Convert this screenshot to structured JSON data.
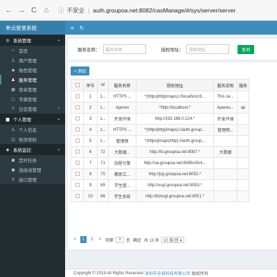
{
  "browser": {
    "back": "←",
    "forward": "→",
    "reload": "C",
    "home": "⌂",
    "info": "ⓘ",
    "security": "不安全",
    "url": "auth.groupoa.net:8082/casManage/#/sys/server/server"
  },
  "header": {
    "logo": "单点登录系统",
    "menu_icon": "≡",
    "refresh_icon": "↻"
  },
  "sidebar": {
    "groups": [
      {
        "label": "系统管理",
        "icon": "◎",
        "items": [
          {
            "label": "首页",
            "icon": "⌂"
          },
          {
            "label": "用户管理",
            "icon": "♙"
          },
          {
            "label": "角色管理",
            "icon": "◆"
          },
          {
            "label": "服务管理",
            "icon": "♟",
            "active": true
          },
          {
            "label": "菜单管理",
            "icon": "▦"
          },
          {
            "label": "字典管理",
            "icon": "▢"
          },
          {
            "label": "日志管理",
            "icon": "≡",
            "caret": "▾"
          }
        ]
      },
      {
        "label": "个人管理",
        "icon": "▆",
        "items": [
          {
            "label": "个人信息",
            "icon": "♙"
          },
          {
            "label": "修改密码",
            "icon": "◫"
          }
        ]
      },
      {
        "label": "系统监控",
        "icon": "◈",
        "items": [
          {
            "label": "定时任务",
            "icon": "◼"
          },
          {
            "label": "连接池管理",
            "icon": "◼"
          },
          {
            "label": "接口管理",
            "icon": "⚲"
          }
        ]
      }
    ]
  },
  "search": {
    "name_label": "服务名称：",
    "name_placeholder": "服务名称",
    "addr_label": "授权地址：",
    "addr_placeholder": "授权地址",
    "query_button": "查询"
  },
  "toolbar": {
    "add_button": "+ 添加"
  },
  "table": {
    "columns": [
      "序号",
      "id",
      "服务名称",
      "授权地址",
      "服务说明",
      "服务"
    ],
    "rows": [
      [
        "1",
        "1...",
        "HTTPS ...",
        "^(https|http|imaps)://localhost:8...",
        "This se...",
        ""
      ],
      [
        "2",
        "1...",
        "Apereo",
        "^http://localhost.*",
        "Apereo...",
        "ap"
      ],
      [
        "3",
        "1...",
        "开发环境",
        "http://192.168.0.124.*",
        "开发环境",
        ""
      ],
      [
        "4",
        "1...",
        "HTTPS ...",
        "^(https|http|imaps)://auth.group...",
        "管理侧...",
        ""
      ],
      [
        "5",
        "1...",
        "管理侧",
        "^(https|imaps|http)://auth.group...",
        "",
        ""
      ],
      [
        "6",
        "72",
        "大数据...",
        "http://bi.groupoa.net:8087.*",
        "大数据",
        ""
      ],
      [
        "7",
        "71",
        "流程引擎",
        "http://oa.groupoa.net:8085/v5mi...",
        "",
        ""
      ],
      [
        "8",
        "70",
        "教职工...",
        "http://jzg.groupoa.net:8052.*",
        "",
        ""
      ],
      [
        "9",
        "69",
        "学生管...",
        "http://xsgl.groupoa.net:8053.*",
        "",
        ""
      ],
      [
        "10",
        "68",
        "学生系统",
        "http://bzksgl.groupoa.net:8051.*",
        "",
        ""
      ]
    ]
  },
  "pager": {
    "prev": "<",
    "page1": "1",
    "page2": "2",
    "next": ">",
    "goto": "到第",
    "goto_value": "1",
    "page_unit": "页",
    "confirm": "确定",
    "total": "共 13 条",
    "page_size": "10 条/页 ▾"
  },
  "footer": {
    "copyright": "Copyright © 2019 All Rights Reserved",
    "company": "深圳市全核科技有限公司",
    "rights": "版权所有"
  }
}
